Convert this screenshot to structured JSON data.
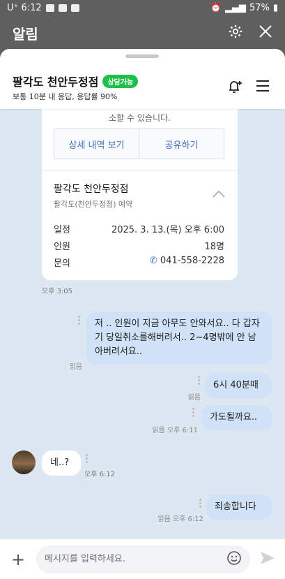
{
  "status": {
    "carrier": "U⁺ 6:12",
    "battery": "57%"
  },
  "appbar": {
    "title": "알림"
  },
  "chat": {
    "name": "팔각도 천안두정점",
    "badge": "상담가능",
    "subtitle": "보통 10분 내 응답, 응답률 90%"
  },
  "card": {
    "cut_text": "소할 수 있습니다.",
    "detail_button": "상세 내역 보기",
    "share_button": "공유하기",
    "title": "팔각도 천안두정점",
    "subtitle": "팔각도(천안두정점) 예약",
    "rows": [
      {
        "label": "일정",
        "value": "2025. 3. 13.(목) 오후 6:00"
      },
      {
        "label": "인원",
        "value": "18명"
      },
      {
        "label": "문의",
        "value": "041-558-2228"
      }
    ],
    "time": "오후 3:05"
  },
  "messages": [
    {
      "text": "저 .. 인원이 지금 아무도 안와서요.. 다 갑자기 당일취소를해버려서.. 2~4명밖에 안 남아버려서요..",
      "meta": "읽음"
    },
    {
      "text": "6시 40분때",
      "meta": "읽음"
    },
    {
      "text": "가도될까요..",
      "meta": "읽음 오후 6:11"
    },
    {
      "text": "네..?",
      "meta": "오후 6:12"
    },
    {
      "text": "죄송합니다",
      "meta": "읽음 오후 6:12"
    }
  ],
  "input": {
    "placeholder": "메시지를 입력하세요."
  }
}
